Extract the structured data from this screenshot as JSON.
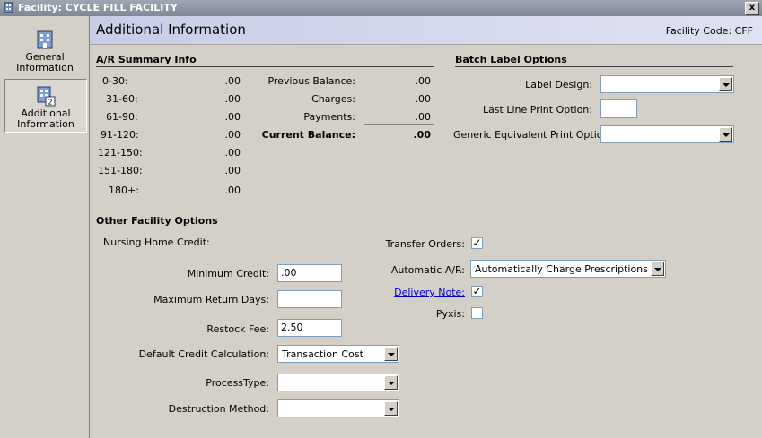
{
  "window": {
    "title": "Facility: CYCLE FILL FACILITY",
    "close": "x"
  },
  "sidebar": {
    "items": [
      {
        "label_line1": "General",
        "label_line2": "Information"
      },
      {
        "label_line1": "Additional",
        "label_line2": "Information"
      }
    ]
  },
  "header": {
    "title": "Additional Information",
    "facility_code_label": "Facility Code:",
    "facility_code": "CFF"
  },
  "ar_summary": {
    "heading": "A/R Summary Info",
    "aging": [
      {
        "label": "0-30:",
        "value": ".00"
      },
      {
        "label": "31-60:",
        "value": ".00"
      },
      {
        "label": "61-90:",
        "value": ".00"
      },
      {
        "label": "91-120:",
        "value": ".00"
      },
      {
        "label": "121-150:",
        "value": ".00"
      },
      {
        "label": "151-180:",
        "value": ".00"
      },
      {
        "label": "180+:",
        "value": ".00"
      }
    ],
    "balance": [
      {
        "label": "Previous Balance:",
        "value": ".00"
      },
      {
        "label": "Charges:",
        "value": ".00"
      },
      {
        "label": "Payments:",
        "value": ".00"
      },
      {
        "label": "Current Balance:",
        "value": ".00"
      }
    ]
  },
  "batch_label": {
    "heading": "Batch Label Options",
    "label_design_label": "Label Design:",
    "label_design_value": "",
    "last_line_label": "Last Line Print Option:",
    "last_line_value": "",
    "generic_label": "Generic Equivalent Print Option:",
    "generic_value": ""
  },
  "other": {
    "heading": "Other Facility Options",
    "nursing_home_credit": "Nursing Home Credit:",
    "minimum_credit_label": "Minimum Credit:",
    "minimum_credit_value": ".00",
    "max_return_days_label": "Maximum Return Days:",
    "max_return_days_value": "",
    "restock_fee_label": "Restock Fee:",
    "restock_fee_value": "2.50",
    "default_credit_label": "Default Credit Calculation:",
    "default_credit_value": "Transaction Cost",
    "process_type_label": "ProcessType:",
    "process_type_value": "",
    "destruction_label": "Destruction Method:",
    "destruction_value": "",
    "transfer_orders_label": "Transfer Orders:",
    "transfer_orders_checked": true,
    "automatic_ar_label": "Automatic A/R:",
    "automatic_ar_value": "Automatically Charge Prescriptions",
    "delivery_note_label": "Delivery Note:",
    "delivery_note_checked": true,
    "pyxis_label": "Pyxis:",
    "pyxis_checked": false
  },
  "colors": {
    "header_bg": "#c8cde6",
    "window_bg": "#d4d0c8",
    "link": "#0000cc",
    "title_bar": "#8a91a0"
  },
  "icons": [
    "building-icon",
    "building-icon-2",
    "close-icon",
    "dropdown-arrow-icon",
    "check-icon"
  ]
}
